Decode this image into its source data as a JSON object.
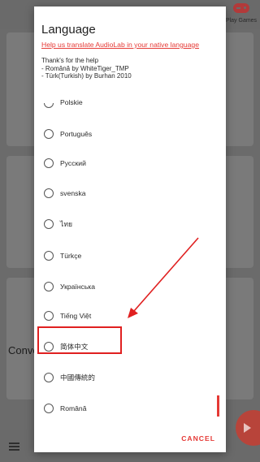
{
  "background": {
    "play_games_label": "Play Games",
    "partial_text": "Conve"
  },
  "dialog": {
    "title": "Language",
    "help_link": "Help us translate AudioLab in your native language",
    "thanks_lines": [
      "Thank's for the help",
      "- Română by WhiteTiger_TMP",
      "- Türk(Turkish) by Burhan 2010"
    ],
    "languages": [
      "Polskie",
      "Português",
      "Русский",
      "svenska",
      "ไทย",
      "Türkçe",
      "Українська",
      "Tiếng Việt",
      "简体中文",
      "中國傳統的",
      "Română"
    ],
    "cancel_label": "CANCEL"
  },
  "annotation": {
    "highlighted_language": "简体中文"
  },
  "colors": {
    "accent": "#e53935",
    "annotation": "#e02020"
  }
}
